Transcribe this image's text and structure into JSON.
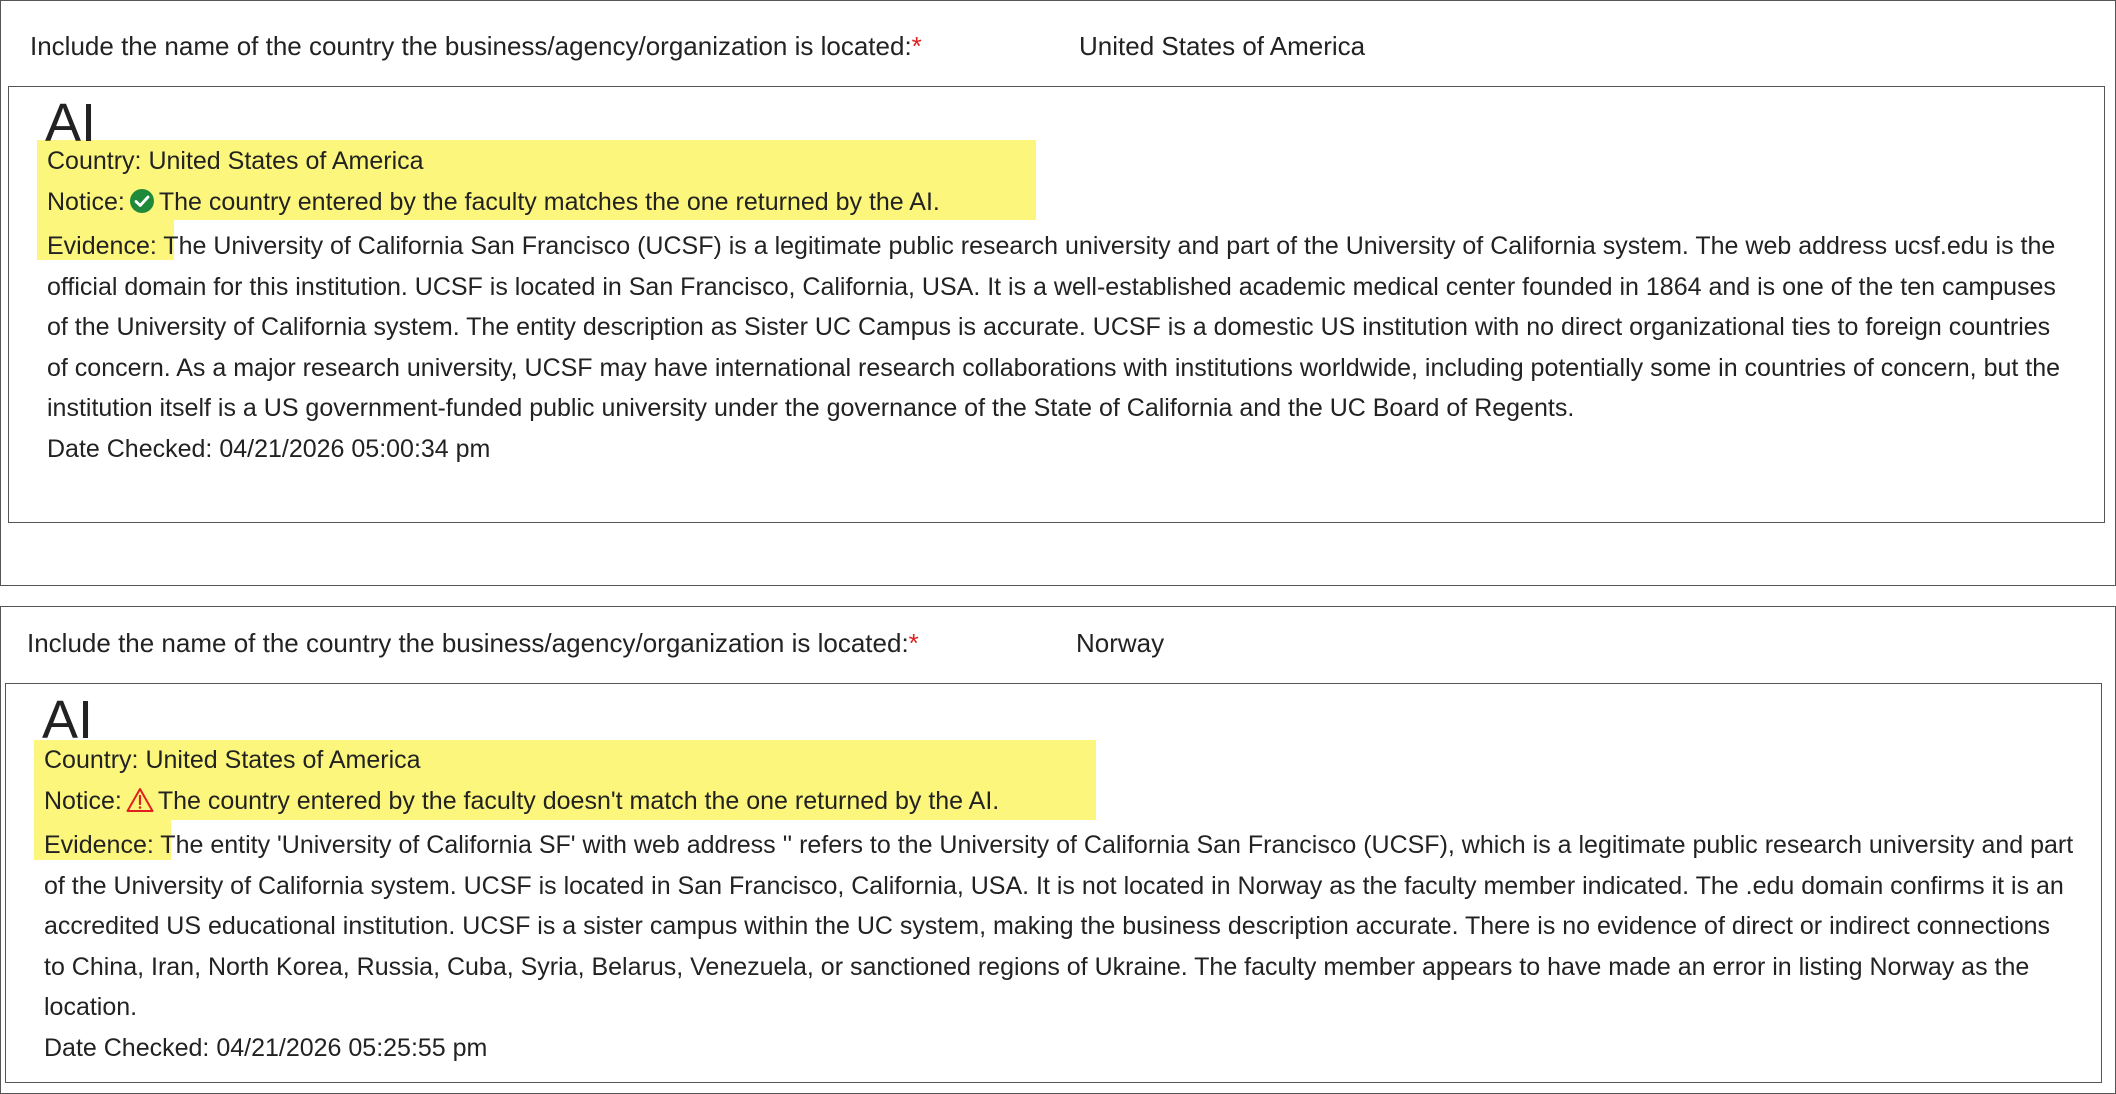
{
  "entries": [
    {
      "question_label": "Include the name of the country the business/agency/organization is located:",
      "required_marker": "*",
      "answer": "United States of America",
      "ai": {
        "title": "AI",
        "country_label": "Country:",
        "country_value": "United States of America",
        "notice_label": "Notice:",
        "notice_icon": "check-circle-icon",
        "notice_icon_color": "#1e8a3a",
        "notice_text": "The country entered by the faculty matches the one returned by the AI.",
        "evidence_label": "Evidence:",
        "evidence_text": "The University of California San Francisco (UCSF) is a legitimate public research university and part of the University of California system. The web address ucsf.edu is the official domain for this institution. UCSF is located in San Francisco, California, USA. It is a well-established academic medical center founded in 1864 and is one of the ten campuses of the University of California system. The entity description as Sister UC Campus is accurate. UCSF is a domestic US institution with no direct organizational ties to foreign countries of concern. As a major research university, UCSF may have international research collaborations with institutions worldwide, including potentially some in countries of concern, but the institution itself is a US government-funded public university under the governance of the State of California and the UC Board of Regents.",
        "date_label": "Date Checked:",
        "date_value": "04/21/2026 05:00:34 pm"
      }
    },
    {
      "question_label": "Include the name of the country the business/agency/organization is located:",
      "required_marker": "*",
      "answer": "Norway",
      "ai": {
        "title": "AI",
        "country_label": "Country:",
        "country_value": "United States of America",
        "notice_label": "Notice:",
        "notice_icon": "warning-triangle-icon",
        "notice_icon_color": "#e02020",
        "notice_text": "The country entered by the faculty doesn't match the one returned by the AI.",
        "evidence_label": "Evidence:",
        "evidence_text": "The entity 'University of California SF' with web address '' refers to the University of California San Francisco (UCSF), which is a legitimate public research university and part of the University of California system. UCSF is located in San Francisco, California, USA. It is not located in Norway as the faculty member indicated. The .edu domain confirms it is an accredited US educational institution. UCSF is a sister campus within the UC system, making the business description accurate. There is no evidence of direct or indirect connections to China, Iran, North Korea, Russia, Cuba, Syria, Belarus, Venezuela, or sanctioned regions of Ukraine. The faculty member appears to have made an error in listing Norway as the location.",
        "date_label": "Date Checked:",
        "date_value": "04/21/2026 05:25:55 pm"
      }
    }
  ],
  "highlight_color": "#fcf77c"
}
